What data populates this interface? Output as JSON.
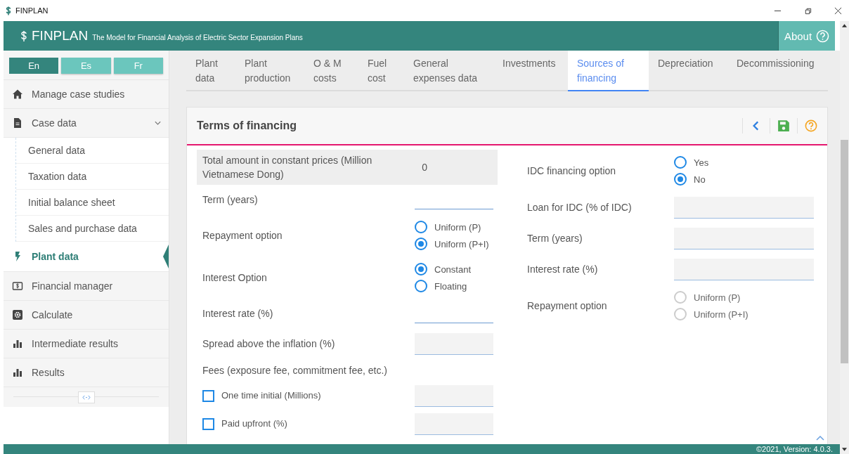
{
  "window": {
    "title": "FINPLAN"
  },
  "header": {
    "title": "FINPLAN",
    "subtitle": "The Model for Financial Analysis of Electric Sector Expansion Plans",
    "about": "About"
  },
  "languages": [
    {
      "label": "En",
      "selected": true
    },
    {
      "label": "Es",
      "selected": false
    },
    {
      "label": "Fr",
      "selected": false
    }
  ],
  "sidebar": {
    "items": [
      {
        "label": "Manage case studies",
        "selected": false
      },
      {
        "label": "Case data",
        "selected": false,
        "expanded": true,
        "children": [
          {
            "label": "General data"
          },
          {
            "label": "Taxation data"
          },
          {
            "label": "Initial balance sheet"
          },
          {
            "label": "Sales and purchase data"
          }
        ]
      },
      {
        "label": "Plant data",
        "selected": true
      },
      {
        "label": "Financial manager",
        "selected": false
      },
      {
        "label": "Calculate",
        "selected": false
      },
      {
        "label": "Intermediate results",
        "selected": false
      },
      {
        "label": "Results",
        "selected": false
      }
    ]
  },
  "tabs": [
    {
      "label": "Plant data",
      "selected": false
    },
    {
      "label": "Plant production",
      "selected": false
    },
    {
      "label": "O & M costs",
      "selected": false
    },
    {
      "label": "Fuel cost",
      "selected": false
    },
    {
      "label": "General expenses data",
      "selected": false
    },
    {
      "label": "Investments",
      "selected": false
    },
    {
      "label": "Sources of financing",
      "selected": true
    },
    {
      "label": "Depreciation",
      "selected": false
    },
    {
      "label": "Decommissioning",
      "selected": false
    }
  ],
  "panel": {
    "title": "Terms of financing",
    "left": [
      {
        "kind": "readonly",
        "label": "Total amount in constant prices (Million Vietnamese Dong)",
        "value": "0"
      },
      {
        "kind": "line_input",
        "label": "Term (years)"
      },
      {
        "kind": "radio",
        "label": "Repayment option",
        "disabled": false,
        "options": [
          {
            "label": "Uniform (P)",
            "selected": false
          },
          {
            "label": "Uniform (P+I)",
            "selected": true
          }
        ]
      },
      {
        "kind": "radio",
        "label": "Interest Option",
        "disabled": false,
        "options": [
          {
            "label": "Constant",
            "selected": true
          },
          {
            "label": "Floating",
            "selected": false
          }
        ]
      },
      {
        "kind": "line_input",
        "label": "Interest rate (%)"
      },
      {
        "kind": "filled_input",
        "label": "Spread above the inflation (%)"
      },
      {
        "kind": "heading",
        "label": "Fees (exposure fee, commitment fee, etc.)"
      },
      {
        "kind": "checkbox",
        "label": "One time initial (Millions)",
        "checked": false
      },
      {
        "kind": "checkbox",
        "label": "Paid upfront (%)",
        "checked": false
      }
    ],
    "right": [
      {
        "kind": "radio",
        "label": "IDC financing option",
        "disabled": false,
        "options": [
          {
            "label": "Yes",
            "selected": false
          },
          {
            "label": "No",
            "selected": true
          }
        ]
      },
      {
        "kind": "filled_input",
        "label": "Loan for IDC (% of IDC)"
      },
      {
        "kind": "filled_input",
        "label": "Term (years)"
      },
      {
        "kind": "filled_input",
        "label": "Interest rate (%)"
      },
      {
        "kind": "radio",
        "label": "Repayment option",
        "disabled": true,
        "options": [
          {
            "label": "Uniform (P)",
            "selected": false
          },
          {
            "label": "Uniform (P+I)",
            "selected": false
          }
        ]
      }
    ]
  },
  "footer": "©2021, Version: 4.0.3."
}
